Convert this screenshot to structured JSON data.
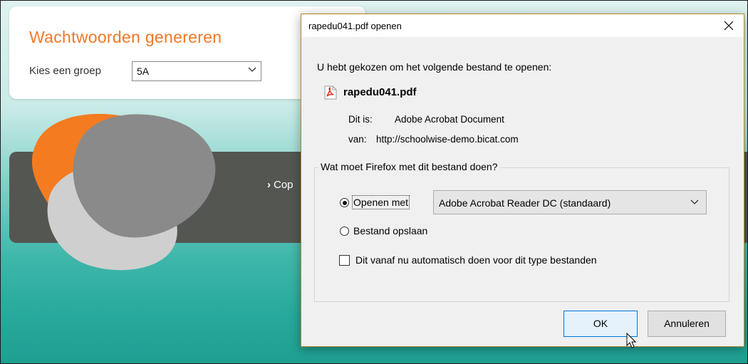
{
  "page": {
    "title": "Wachtwoorden genereren",
    "group_label": "Kies een groep",
    "group_value": "5A",
    "band_link": "Cop"
  },
  "colors": {
    "accent_orange": "#f07828",
    "teal": "#27a99c",
    "dark_band": "#545652",
    "ok_border": "#0078d7"
  },
  "dialog": {
    "title": "rapedu041.pdf openen",
    "intro": "U hebt gekozen om het volgende bestand te openen:",
    "filename": "rapedu041.pdf",
    "kind_label": "Dit is:",
    "kind_value": "Adobe Acrobat Document",
    "from_label": "van:",
    "from_value": "http://schoolwise-demo.bicat.com",
    "question": "Wat moet Firefox met dit bestand doen?",
    "open_with_label": "Openen met",
    "open_with_selected": true,
    "app_value": "Adobe Acrobat Reader DC  (standaard)",
    "save_label": "Bestand opslaan",
    "auto_label": "Dit vanaf nu automatisch doen voor dit type bestanden",
    "auto_checked": false,
    "ok_label": "OK",
    "cancel_label": "Annuleren",
    "icons": [
      "pdf-file-icon",
      "close-icon",
      "chevron-down-icon",
      "mouse-cursor-icon"
    ]
  }
}
